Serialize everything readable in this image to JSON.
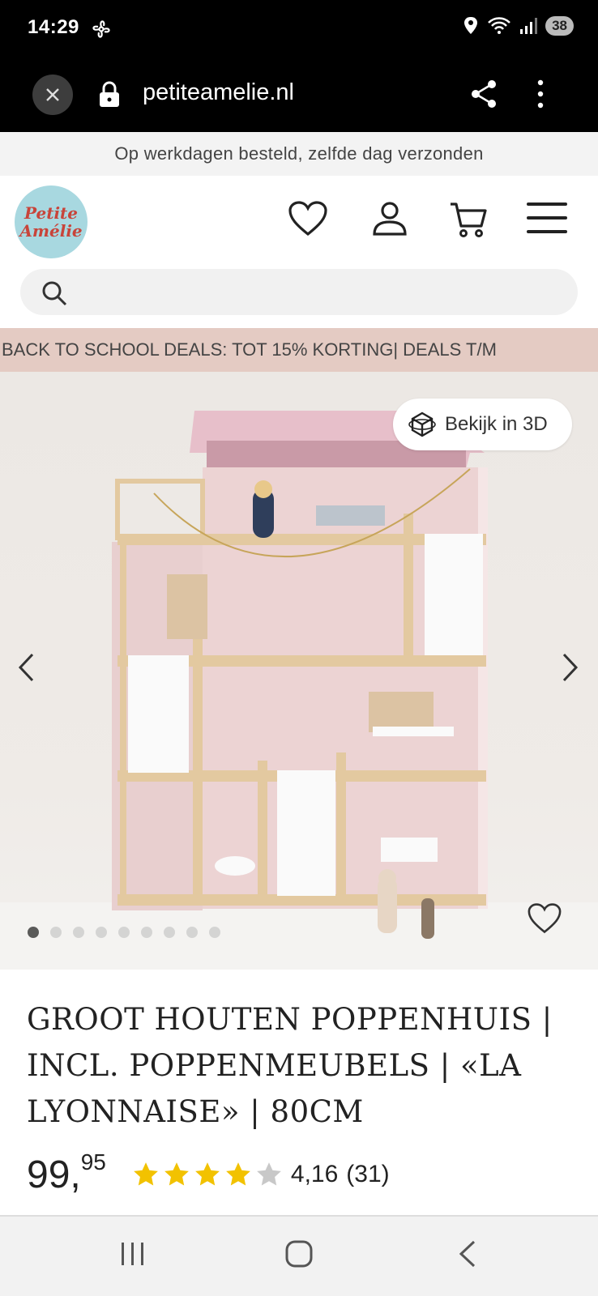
{
  "status_bar": {
    "time": "14:29",
    "battery": "38"
  },
  "browser": {
    "url": "petiteamelie.nl"
  },
  "shipping_banner": {
    "text": "Op werkdagen besteld, zelfde dag verzonden"
  },
  "header": {
    "logo_line1": "Petite",
    "logo_line2": "Amélie"
  },
  "promo_banner": {
    "text": "BACK TO SCHOOL DEALS: TOT 15% KORTING| DEALS T/M"
  },
  "gallery": {
    "view_3d_label": "Bekijk in 3D",
    "dot_count": 9,
    "active_dot": 0
  },
  "product": {
    "title": "GROOT HOUTEN POPPENHUIS | INCL. POPPENMEUBELS | «LA LYONNAISE» | 80CM",
    "price_main": "99,",
    "price_cents": "95",
    "rating_value": "4,16",
    "review_count": "(31)",
    "stars_filled": 4,
    "stars_total": 5
  },
  "colors": {
    "accent_star": "#f2c200",
    "promo_bg": "#e4cbc3",
    "logo_bg": "#a8d8e0"
  }
}
